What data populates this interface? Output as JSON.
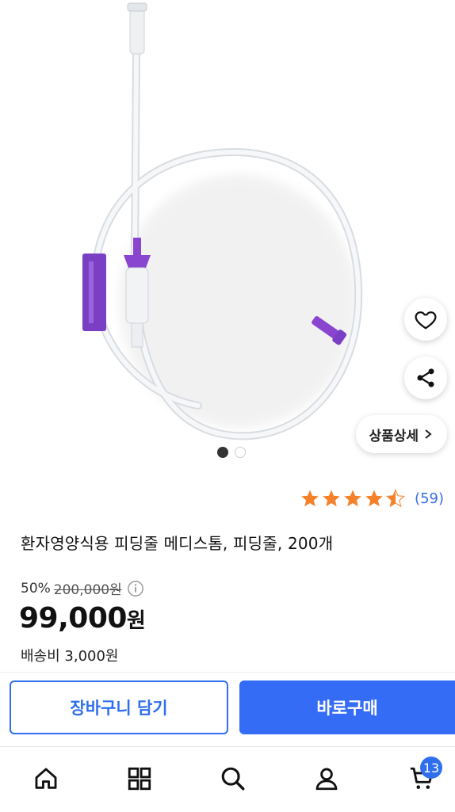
{
  "product": {
    "title": "환자영양식용 피딩줄 메디스톰, 피딩줄, 200개",
    "discount": "50%",
    "original_price": "200,000원",
    "price_number": "99,000",
    "price_unit": "원",
    "shipping": "배송비 3,000원",
    "rating": 4.5,
    "review_count": "(59)"
  },
  "gallery": {
    "detail_label": "상품상세",
    "image_count": 2,
    "current_index": 1
  },
  "actions": {
    "cart_label": "장바구니 담기",
    "buy_label": "바로구매"
  },
  "nav": {
    "cart_badge": "13",
    "items": [
      "home-icon",
      "category-grid-icon",
      "search-icon",
      "user-icon",
      "cart-icon"
    ]
  },
  "colors": {
    "accent": "#356cf6",
    "star": "#f5822a",
    "review_count": "#3a6ee8",
    "tube_accent": "#7b3fc4"
  }
}
